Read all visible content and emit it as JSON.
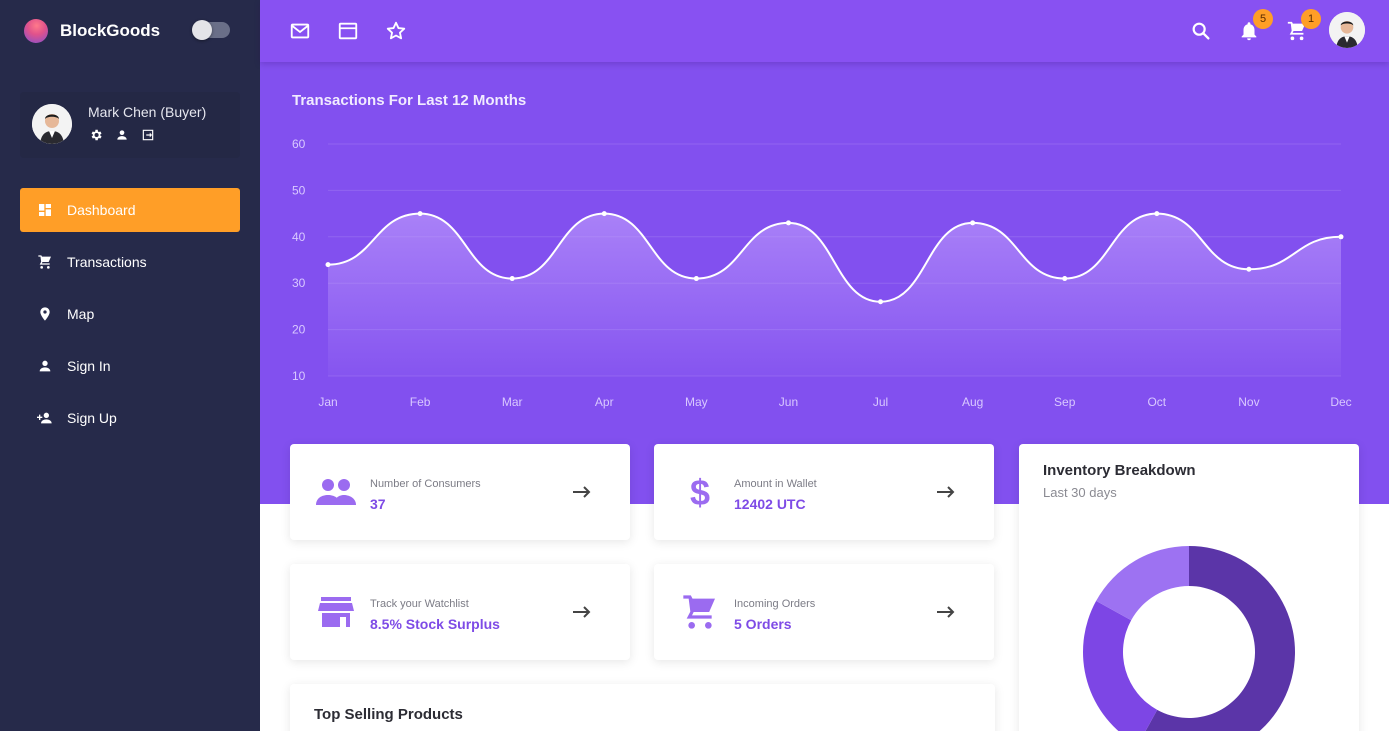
{
  "brand": {
    "name": "BlockGoods"
  },
  "user": {
    "name": "Mark Chen (Buyer)"
  },
  "nav": {
    "items": [
      {
        "label": "Dashboard",
        "icon": "dashboard-icon",
        "active": true
      },
      {
        "label": "Transactions",
        "icon": "cart-icon",
        "active": false
      },
      {
        "label": "Map",
        "icon": "map-pin-icon",
        "active": false
      },
      {
        "label": "Sign In",
        "icon": "person-icon",
        "active": false
      },
      {
        "label": "Sign Up",
        "icon": "person-add-icon",
        "active": false
      }
    ]
  },
  "topbar": {
    "notifications_count": "5",
    "cart_count": "1"
  },
  "chart_data": {
    "type": "area",
    "title": "Transactions For Last 12 Months",
    "categories": [
      "Jan",
      "Feb",
      "Mar",
      "Apr",
      "May",
      "Jun",
      "Jul",
      "Aug",
      "Sep",
      "Oct",
      "Nov",
      "Dec"
    ],
    "values": [
      34,
      45,
      31,
      45,
      31,
      43,
      26,
      43,
      31,
      45,
      33,
      40
    ],
    "yticks": [
      60,
      50,
      40,
      30,
      20,
      10
    ],
    "ylim": [
      10,
      60
    ],
    "grid": true
  },
  "stats": [
    {
      "label": "Number of Consumers",
      "value": "37",
      "icon": "people-icon"
    },
    {
      "label": "Amount in Wallet",
      "value": "12402 UTC",
      "icon": "dollar-icon"
    },
    {
      "label": "Track your Watchlist",
      "value": "8.5% Stock Surplus",
      "icon": "store-icon"
    },
    {
      "label": "Incoming Orders",
      "value": "5 Orders",
      "icon": "cart-icon"
    }
  ],
  "top_selling": {
    "title": "Top Selling Products"
  },
  "inventory": {
    "title": "Inventory Breakdown",
    "subtitle": "Last 30 days",
    "slices": [
      {
        "value": 0.58,
        "color": "#5b35a8"
      },
      {
        "value": 0.25,
        "color": "#7d46e5"
      },
      {
        "value": 0.17,
        "color": "#9d72f2"
      }
    ]
  },
  "colors": {
    "accent": "#ff9e27",
    "primary": "#8250ef",
    "sidebar": "#262a4a"
  }
}
